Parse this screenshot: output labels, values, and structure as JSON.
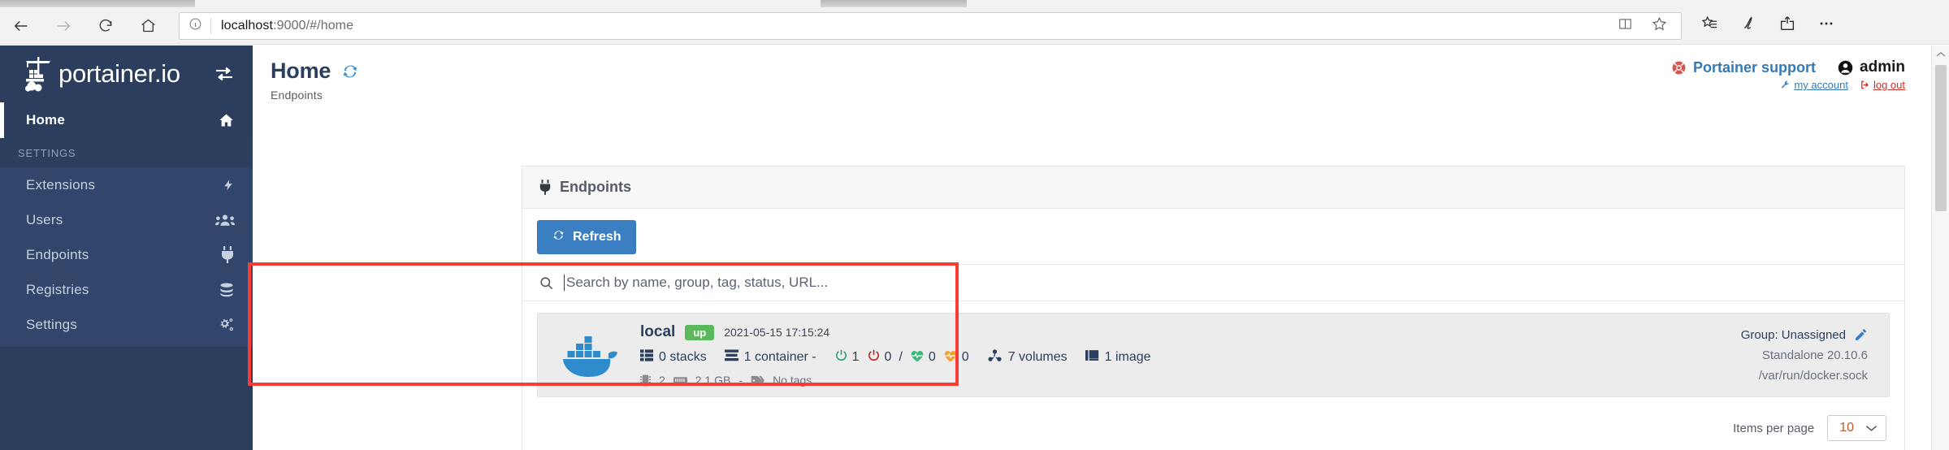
{
  "browser": {
    "back_icon": "back-arrow-icon",
    "forward_icon": "forward-arrow-icon",
    "reload_icon": "reload-icon",
    "home_icon": "home-icon",
    "info_icon": "info-icon",
    "url_main": "localhost",
    "url_rest": ":9000/#/home",
    "reading_view_icon": "reading-view-icon",
    "favorite_icon": "star-icon",
    "favorites_hub_icon": "favorites-list-icon",
    "web_note_icon": "pen-icon",
    "share_icon": "share-icon",
    "more_icon": "ellipsis-icon"
  },
  "sidebar": {
    "brand": "portainer.io",
    "brand_logo_icon": "portainer-crane-logo",
    "toggle_icon": "collapse-sidebar-icon",
    "home": {
      "label": "Home",
      "icon": "house-icon"
    },
    "section_title": "SETTINGS",
    "items": [
      {
        "label": "Extensions",
        "icon": "bolt-icon"
      },
      {
        "label": "Users",
        "icon": "users-icon"
      },
      {
        "label": "Endpoints",
        "icon": "plug-icon"
      },
      {
        "label": "Registries",
        "icon": "database-icon"
      },
      {
        "label": "Settings",
        "icon": "gears-icon"
      }
    ]
  },
  "header": {
    "title": "Home",
    "refresh_icon": "refresh-icon",
    "breadcrumb": "Endpoints",
    "support_label": "Portainer support",
    "support_icon": "life-ring-icon",
    "user_name": "admin",
    "user_icon": "user-circle-icon",
    "my_account_label": "my account",
    "my_account_icon": "wrench-icon",
    "logout_label": "log out",
    "logout_icon": "sign-out-icon"
  },
  "panel": {
    "title": "Endpoints",
    "title_icon": "plug-icon",
    "refresh_button": "Refresh",
    "refresh_button_icon": "sync-icon",
    "search": {
      "icon": "search-icon",
      "placeholder": "Search by name, group, tag, status, URL...",
      "value": ""
    },
    "footer": {
      "items_per_page_label": "Items per page",
      "items_per_page_value": "10",
      "chevron_icon": "chevron-down-icon"
    }
  },
  "endpoints": [
    {
      "logo_icon": "docker-whale-logo",
      "name": "local",
      "status_badge": "up",
      "status_color": "#5bb85c",
      "timestamp": "2021-05-15 17:15:24",
      "stats": {
        "stacks_icon": "stacks-icon",
        "stacks": "0 stacks",
        "containers_icon": "containers-icon",
        "containers": "1 container -",
        "running_icon": "power-on-icon",
        "running_count": "1",
        "running_color": "#2aa26a",
        "stopped_icon": "power-off-icon",
        "stopped_count": "0",
        "stopped_color": "#b8262b",
        "separator": "/",
        "healthy_icon": "heartbeat-icon",
        "healthy_count": "0",
        "healthy_color": "#3cb878",
        "unhealthy_icon": "heartbeat-icon",
        "unhealthy_count": "0",
        "unhealthy_color": "#f0a330",
        "volumes_icon": "volumes-icon",
        "volumes": "7 volumes",
        "images_icon": "images-icon",
        "images": "1 image"
      },
      "resources": {
        "cpu_icon": "cpu-icon",
        "cpu": "2",
        "memory_icon": "memory-icon",
        "memory": "2.1 GB",
        "dash": "-",
        "tags_icon": "tag-icon",
        "tags": "No tags"
      },
      "group_label": "Group: Unassigned",
      "group_edit_icon": "pencil-icon",
      "engine": "Standalone 20.10.6",
      "url": "/var/run/docker.sock"
    }
  ],
  "annotation": {
    "highlight_color": "#fb3b35"
  },
  "scrollbar": {
    "up_icon": "chevron-up-icon"
  }
}
